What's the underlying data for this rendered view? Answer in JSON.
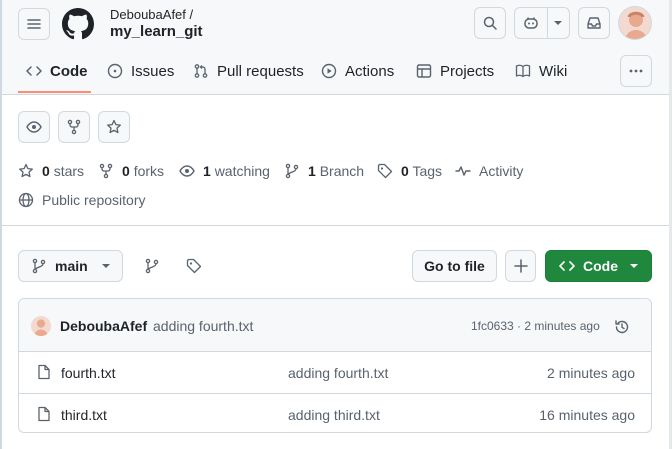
{
  "header": {
    "owner": "DeboubaAfef /",
    "repo": "my_learn_git"
  },
  "tabs": [
    {
      "label": "Code"
    },
    {
      "label": "Issues"
    },
    {
      "label": "Pull requests"
    },
    {
      "label": "Actions"
    },
    {
      "label": "Projects"
    },
    {
      "label": "Wiki"
    }
  ],
  "stats": {
    "stars_count": "0",
    "stars_label": "stars",
    "forks_count": "0",
    "forks_label": "forks",
    "watching_count": "1",
    "watching_label": "watching",
    "branch_count": "1",
    "branch_label": "Branch",
    "tags_count": "0",
    "tags_label": "Tags",
    "activity_label": "Activity",
    "visibility": "Public repository"
  },
  "toolbar": {
    "branch": "main",
    "go_to_file": "Go to file",
    "code_button": "Code"
  },
  "latest_commit": {
    "author": "DeboubaAfef",
    "message": "adding fourth.txt",
    "hash_time": "1fc0633 · 2 minutes ago"
  },
  "files": [
    {
      "name": "fourth.txt",
      "commit": "adding fourth.txt",
      "time": "2 minutes ago"
    },
    {
      "name": "third.txt",
      "commit": "adding third.txt",
      "time": "16 minutes ago"
    }
  ],
  "colors": {
    "accent_green": "#1f883d",
    "underline_orange": "#fd8c73",
    "muted": "#59636e"
  }
}
